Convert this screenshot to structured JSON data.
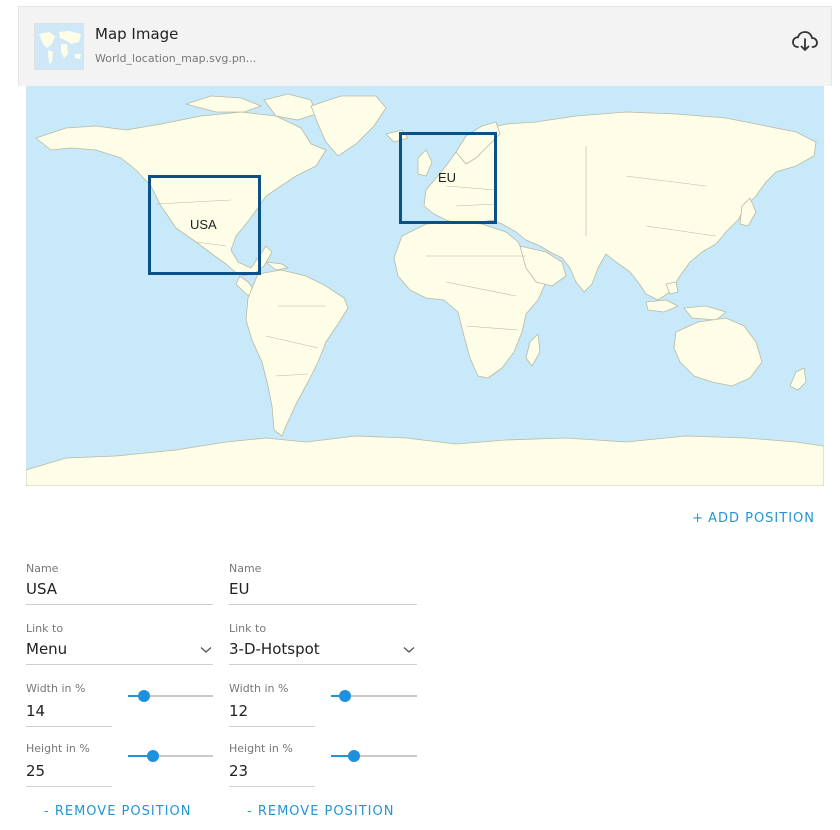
{
  "file": {
    "title": "Map Image",
    "filename": "World_location_map.svg.pn...",
    "download_icon": "cloud-download-icon"
  },
  "colors": {
    "ocean": "#c7e9f9",
    "land": "#fefde8",
    "border": "#b9b9a4",
    "hotspot": "#0b5087",
    "accent": "#2196d4"
  },
  "actions": {
    "add_position": "ADD POSITION",
    "add_prefix": "+",
    "remove_position": "REMOVE POSITION",
    "remove_prefix": "-"
  },
  "positions": [
    {
      "name_label": "Name",
      "name": "USA",
      "link_label": "Link to",
      "link": "Menu",
      "width_label": "Width in %",
      "width": "14",
      "height_label": "Height in %",
      "height": "25"
    },
    {
      "name_label": "Name",
      "name": "EU",
      "link_label": "Link to",
      "link": "3-D-Hotspot",
      "width_label": "Width in %",
      "width": "12",
      "height_label": "Height in %",
      "height": "23"
    }
  ]
}
